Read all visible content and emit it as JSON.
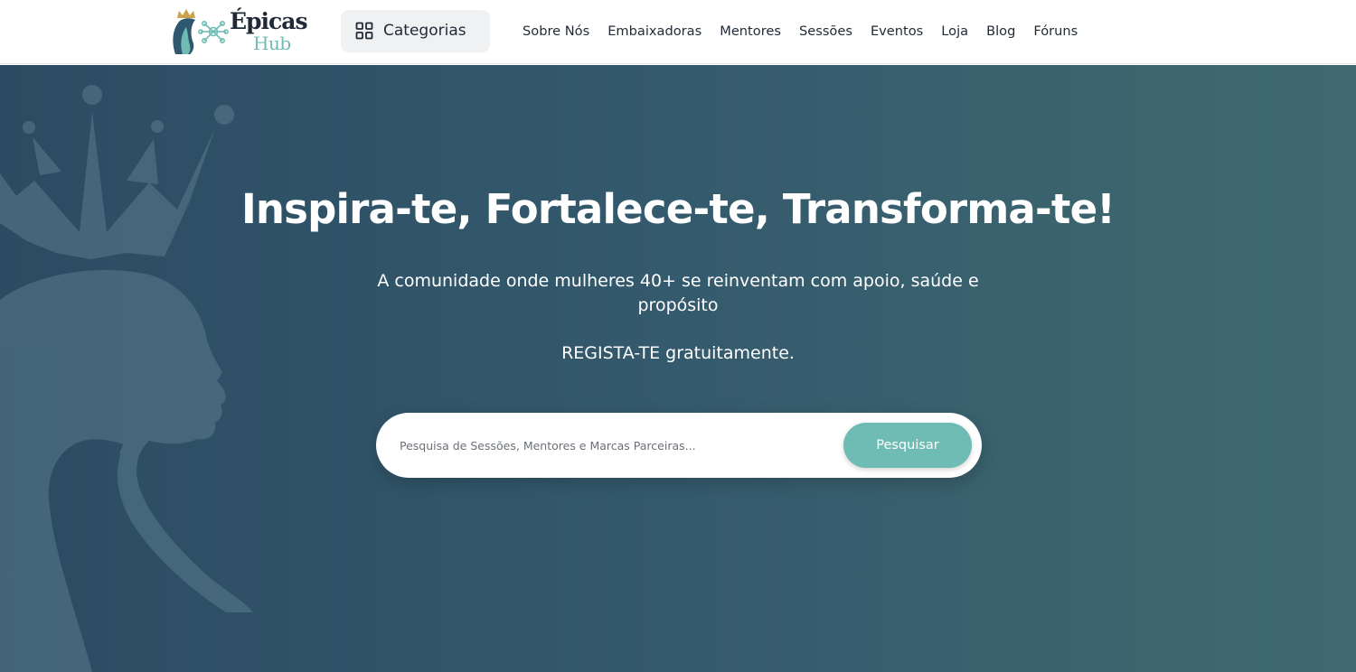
{
  "brand": {
    "logo_line1": "Épicas",
    "logo_line2": "Hub",
    "colors": {
      "dark": "#1f2a36",
      "teal": "#6fbcb4",
      "gold": "#c9a24a"
    }
  },
  "header": {
    "categories_label": "Categorias",
    "categories_icon": "grid-icon",
    "menu": [
      {
        "label": "Sobre Nós"
      },
      {
        "label": "Embaixadoras"
      },
      {
        "label": "Mentores"
      },
      {
        "label": "Sessões"
      },
      {
        "label": "Eventos"
      },
      {
        "label": "Loja"
      },
      {
        "label": "Blog"
      },
      {
        "label": "Fóruns"
      }
    ]
  },
  "hero": {
    "title": "Inspira-te, Fortalece-te, Transforma-te!",
    "subtitle": "A comunidade onde mulheres 40+ se reinventam com apoio, saúde e propósito",
    "cta_text": "REGISTA-TE gratuitamente.",
    "background_colors": [
      "#2c4b62",
      "#406a6f"
    ]
  },
  "search": {
    "placeholder": "Pesquisa de Sessões, Mentores e Marcas Parceiras...",
    "value": "",
    "button_label": "Pesquisar"
  }
}
